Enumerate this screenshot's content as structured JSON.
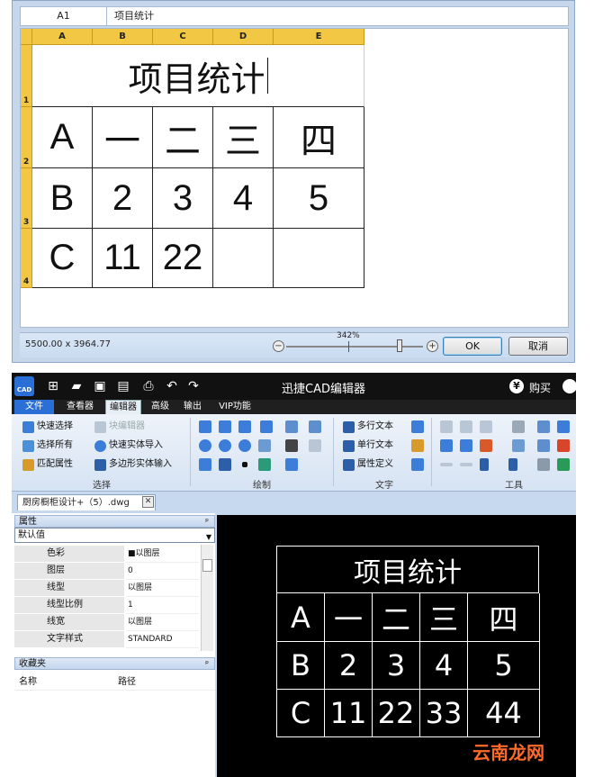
{
  "dialog": {
    "cell_ref": "A1",
    "cell_content": "项目统计",
    "columns": [
      "A",
      "B",
      "C",
      "D",
      "E"
    ],
    "rows": [
      "1",
      "2",
      "3",
      "4"
    ],
    "table": {
      "title": "项目统计",
      "row2": [
        "A",
        "一",
        "二",
        "三",
        "四"
      ],
      "row3": [
        "B",
        "2",
        "3",
        "4",
        "5"
      ],
      "row4": [
        "C",
        "11",
        "22",
        "",
        ""
      ]
    },
    "status": {
      "dimensions": "5500.00 x 3964.77",
      "zoom": "342%",
      "zoom_minus": "−",
      "zoom_plus": "+",
      "ok": "OK",
      "cancel": "取消"
    }
  },
  "app": {
    "title": "迅捷CAD编辑器",
    "logo_text": "CAD",
    "buy_label": "购买",
    "buy_icon_glyph": "¥",
    "menu": [
      "文件",
      "查看器",
      "编辑器",
      "高级",
      "输出",
      "VIP功能"
    ],
    "active_menu": "编辑器",
    "ribbon": {
      "select_group": {
        "label": "选择",
        "items": [
          "快速选择",
          "选择所有",
          "匹配属性",
          "块编辑器",
          "快速实体导入",
          "多边形实体输入"
        ]
      },
      "draw_group": {
        "label": "绘制"
      },
      "text_group": {
        "label": "文字",
        "items": [
          "多行文本",
          "单行文本",
          "属性定义"
        ]
      },
      "tools_group": {
        "label": "工具"
      }
    },
    "document_tab": "厨房橱柜设计+（5）.dwg",
    "document_tab_close": "✕",
    "properties": {
      "header": "属性",
      "pin": "ᵖ",
      "selector": "默认值",
      "rows": [
        {
          "name": "色彩",
          "value": "■以图层"
        },
        {
          "name": "图层",
          "value": "0"
        },
        {
          "name": "线型",
          "value": "以图层"
        },
        {
          "name": "线型比例",
          "value": "1"
        },
        {
          "name": "线宽",
          "value": "以图层"
        },
        {
          "name": "文字样式",
          "value": "STANDARD"
        }
      ]
    },
    "favorites": {
      "header": "收藏夹",
      "col_name": "名称",
      "col_path": "路径"
    },
    "cad_table": {
      "title": "项目统计",
      "row2": [
        "A",
        "一",
        "二",
        "三",
        "四"
      ],
      "row3": [
        "B",
        "2",
        "3",
        "4",
        "5"
      ],
      "row4": [
        "C",
        "11",
        "22",
        "33",
        "44"
      ]
    },
    "watermark": "云南龙网"
  }
}
